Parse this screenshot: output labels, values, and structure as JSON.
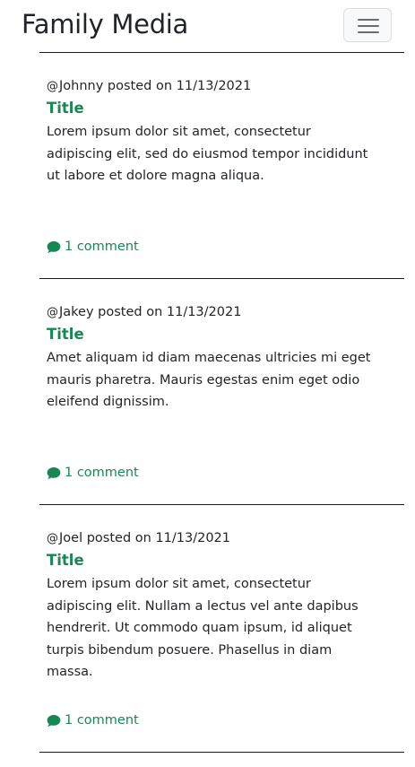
{
  "navbar": {
    "brand": "Family Media",
    "toggler_icon": "hamburger-menu-icon"
  },
  "posts": [
    {
      "at_symbol": "@",
      "author": "Johnny",
      "posted_text": "posted on 11/13/2021",
      "title": "Title",
      "body": "Lorem ipsum dolor sit amet, consectetur adipiscing elit, sed do eiusmod tempor incididunt ut labore et dolore magna aliqua.",
      "comment_icon": "chat-bubble-icon",
      "comment_label": "1 comment"
    },
    {
      "at_symbol": "@",
      "author": "Jakey",
      "posted_text": "posted on 11/13/2021",
      "title": "Title",
      "body": "Amet aliquam id diam maecenas ultricies mi eget mauris pharetra. Mauris egestas enim eget odio eleifend dignissim.",
      "comment_icon": "chat-bubble-icon",
      "comment_label": "1 comment"
    },
    {
      "at_symbol": "@",
      "author": "Joel",
      "posted_text": "posted on 11/13/2021",
      "title": "Title",
      "body": "Lorem ipsum dolor sit amet, consectetur adipiscing elit. Nullam a lectus vel ante dapibus hendrerit. Ut commodo quam ipsum, id aliquet turpis bibendum posuere. Phasellus in diam massa.",
      "comment_icon": "chat-bubble-icon",
      "comment_label": "1 comment"
    }
  ],
  "colors": {
    "accent": "#198754",
    "text": "#212529",
    "divider": "#1a1a1a"
  }
}
